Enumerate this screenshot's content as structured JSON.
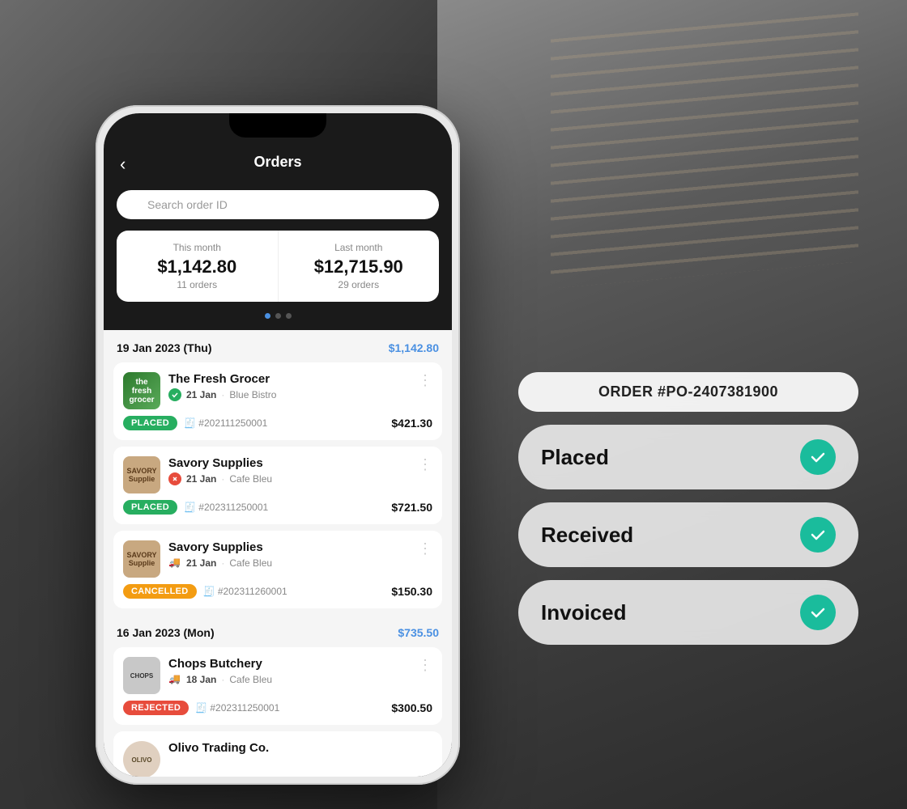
{
  "background": {
    "description": "Kitchen restaurant background"
  },
  "phone": {
    "header": {
      "back_label": "‹",
      "title": "Orders"
    },
    "search": {
      "placeholder": "Search order ID"
    },
    "stats": {
      "this_month": {
        "label": "This month",
        "amount": "$1,142.80",
        "orders": "11 orders"
      },
      "last_month": {
        "label": "Last month",
        "amount": "$12,715.90",
        "orders": "29 orders"
      }
    },
    "date_groups": [
      {
        "date": "19 Jan 2023 (Thu)",
        "total": "$1,142.80",
        "orders": [
          {
            "supplier": "The Fresh Grocer",
            "logo_text": "the\nfresh\ngrocer",
            "logo_class": "logo-fresh",
            "date": "21 Jan",
            "venue": "Blue Bistro",
            "status": "PLACED",
            "status_class": "badge-placed",
            "order_id": "#202111250001",
            "amount": "$421.30",
            "icon_type": "check"
          },
          {
            "supplier": "Savory Supplies",
            "logo_text": "SAVORY\nSupplie",
            "logo_class": "logo-savory",
            "date": "21 Jan",
            "venue": "Cafe Bleu",
            "status": "PLACED",
            "status_class": "badge-placed",
            "order_id": "#202311250001",
            "amount": "$721.50",
            "icon_type": "x"
          },
          {
            "supplier": "Savory Supplies",
            "logo_text": "SAVORY\nSupplie",
            "logo_class": "logo-savory",
            "date": "21 Jan",
            "venue": "Cafe Bleu",
            "status": "CANCELLED",
            "status_class": "badge-cancelled",
            "order_id": "#202311260001",
            "amount": "$150.30",
            "icon_type": "truck"
          }
        ]
      },
      {
        "date": "16 Jan 2023 (Mon)",
        "total": "$735.50",
        "orders": [
          {
            "supplier": "Chops Butchery",
            "logo_text": "CHOPS",
            "logo_class": "logo-chops",
            "date": "18 Jan",
            "venue": "Cafe Bleu",
            "status": "REJECTED",
            "status_class": "badge-rejected",
            "order_id": "#202311250001",
            "amount": "$300.50",
            "icon_type": "truck"
          },
          {
            "supplier": "Olivo Trading Co.",
            "logo_text": "OLIVO",
            "logo_class": "logo-olivo",
            "date": "",
            "venue": "",
            "status": "",
            "status_class": "",
            "order_id": "",
            "amount": "",
            "icon_type": "check"
          }
        ]
      }
    ]
  },
  "order_panel": {
    "order_number": "ORDER #PO-2407381900",
    "steps": [
      {
        "label": "Placed",
        "checked": true
      },
      {
        "label": "Received",
        "checked": true
      },
      {
        "label": "Invoiced",
        "checked": true
      }
    ]
  }
}
